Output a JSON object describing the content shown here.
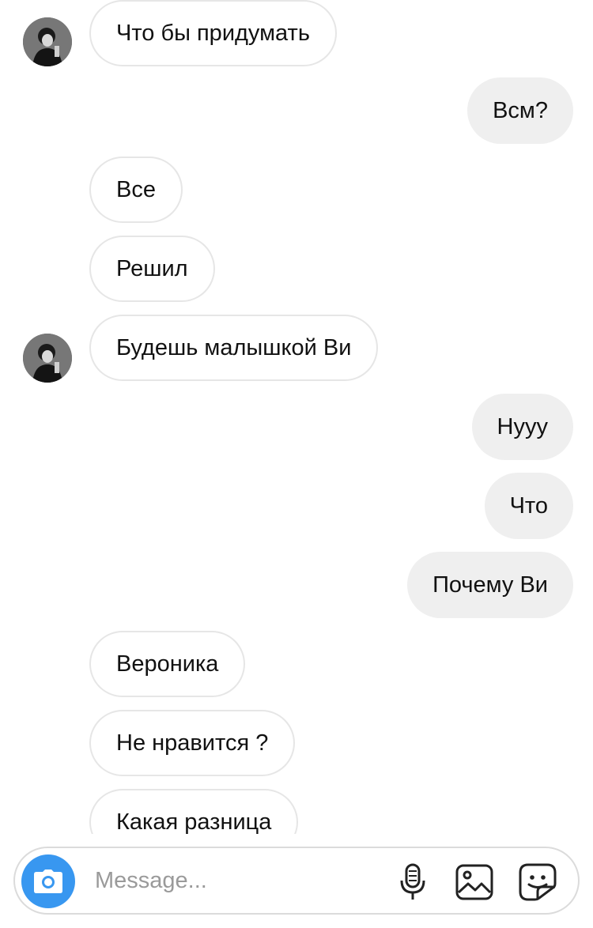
{
  "thread": {
    "messages": [
      {
        "side": "in",
        "text": "Что бы придумать"
      },
      {
        "side": "out",
        "text": "Всм?"
      },
      {
        "side": "in",
        "text": "Все"
      },
      {
        "side": "in",
        "text": "Решил"
      },
      {
        "side": "in",
        "text": "Будешь малышкой Ви"
      },
      {
        "side": "out",
        "text": "Нууу"
      },
      {
        "side": "out",
        "text": "Что"
      },
      {
        "side": "out",
        "text": "Почему Ви"
      },
      {
        "side": "in",
        "text": "Вероника"
      },
      {
        "side": "in",
        "text": "Не нравится ?"
      },
      {
        "side": "in",
        "text": "Какая разница"
      }
    ]
  },
  "composer": {
    "placeholder": "Message...",
    "value": "",
    "camera_icon": "camera-icon",
    "mic_icon": "microphone-icon",
    "gallery_icon": "gallery-icon",
    "sticker_icon": "sticker-icon",
    "accent_color": "#3897f0"
  }
}
